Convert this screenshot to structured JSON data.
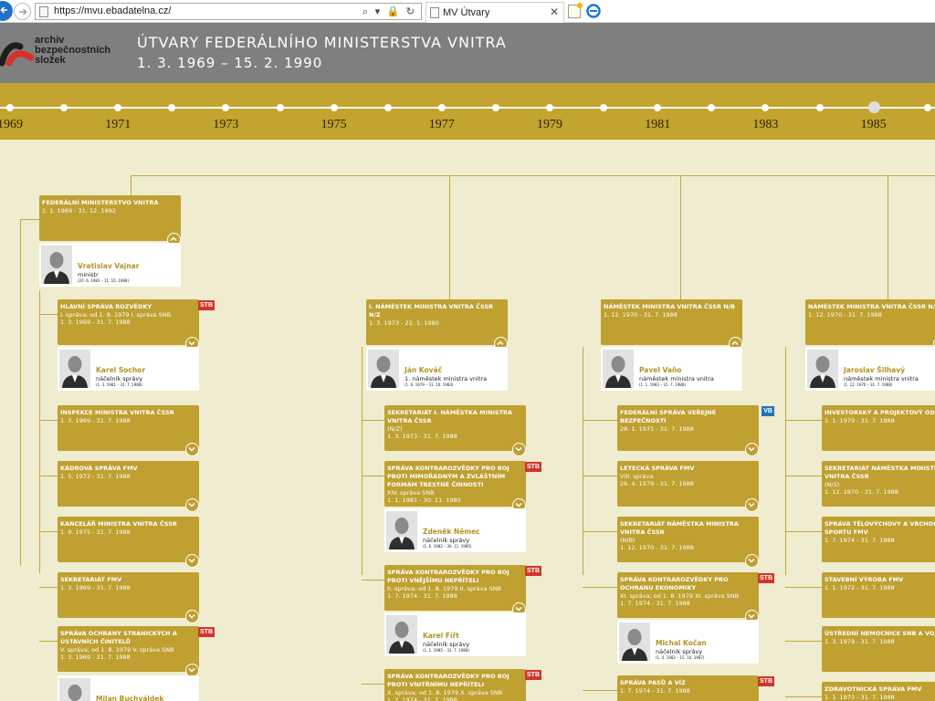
{
  "browser": {
    "url": "https://mvu.ebadatelna.cz/",
    "address_tools": "⌕ ▾ 🔒 ↻",
    "tab_title": "MV Útvary",
    "tab_close": "✕"
  },
  "header": {
    "logo_line1": "archiv",
    "logo_line2": "bezpečnostních",
    "logo_line3": "složek",
    "title": "ÚTVARY FEDERÁLNÍHO MINISTERSTVA VNITRA",
    "subtitle": "1. 3. 1969 – 15. 2. 1990"
  },
  "timeline": {
    "years": [
      "1969",
      "1971",
      "1973",
      "1975",
      "1977",
      "1979",
      "1981",
      "1983",
      "1985"
    ]
  },
  "colors": {
    "gold": "#bfa030",
    "header_gray": "#7f7f7f",
    "background": "#efeccf",
    "stb_badge": "#d2362a",
    "vb_badge": "#2473b8",
    "person_name": "#b19420"
  },
  "org": {
    "root": {
      "name": "FEDERÁLNÍ MINISTERSTVO VNITRA",
      "dates": "1. 1. 1969 - 31. 12. 1992",
      "person": {
        "name": "Vratislav Vajnar",
        "role": "ministr",
        "dates": "(20. 6. 1983 – 11. 10. 1988)"
      }
    },
    "col1": [
      {
        "name": "HLAVNÍ SPRÁVA ROZVĚDKY",
        "note": "I. správa; od 1. 8. 1979 I. správa SNB",
        "dates": "1. 3. 1969 - 31. 7. 1988",
        "badge": "STB",
        "person": {
          "name": "Karel Sochor",
          "role": "náčelník správy",
          "dates": "(1. 3. 1981 – 31. 7. 1988)"
        }
      },
      {
        "name": "INSPEKCE MINISTRA VNITRA ČSSR",
        "dates": "1. 3. 1969 - 31. 7. 1988"
      },
      {
        "name": "KÁDROVÁ SPRÁVA FMV",
        "dates": "1. 5. 1972 - 31. 7. 1988"
      },
      {
        "name": "KANCELÁŘ MINISTRA VNITRA ČSSR",
        "dates": "1. 9. 1975 - 31. 7. 1988"
      },
      {
        "name": "SEKRETARIÁT FMV",
        "dates": "1. 3. 1969 - 31. 7. 1988"
      },
      {
        "name": "SPRÁVA OCHRANY STRANICKÝCH A ÚSTAVNÍCH ČINITELŮ",
        "note": "V. správa; od 1. 8. 1979 V. správa SNB",
        "dates": "1. 3. 1969 - 31. 7. 1988",
        "badge": "STB",
        "person": {
          "name": "Milan Buchváldek"
        }
      }
    ],
    "col2": {
      "head": {
        "name": "I. NÁMĚSTEK MINISTRA VNITRA ČSSR N/Z",
        "dates": "1. 3. 1973 - 22. 1. 1990",
        "person": {
          "name": "Ján Kováč",
          "role": "1. náměstek ministra vnitra",
          "dates": "(1. 6. 1979 – 31. 10. 1983)"
        }
      },
      "items": [
        {
          "name": "SEKRETARIÁT I. NÁMĚSTKA MINISTRA VNITRA ČSSR",
          "note": "(N/Z)",
          "dates": "1. 3. 1973 - 31. 7. 1988"
        },
        {
          "name": "SPRÁVA KONTRAROZVĚDKY PRO BOJ PROTI MIMOŘÁDNÝM A ZVLÁŠTNÍM FORMÁM TRESTNÉ ČINNOSTI",
          "note": "XIV. správa SNB",
          "dates": "1. 1. 1981 - 30. 11. 1985",
          "badge": "STB",
          "person": {
            "name": "Zdeněk Němec",
            "role": "náčelník správy",
            "dates": "(1. 6. 1982 – 30. 11. 1985)"
          }
        },
        {
          "name": "SPRÁVA KONTRAROZVĚDKY PRO BOJ PROTI VNĚJŠÍMU NEPŘÍTELI",
          "note": "II. správa; od 1. 8. 1979 II. správa SNB",
          "dates": "1. 7. 1974 - 31. 7. 1988",
          "badge": "STB",
          "person": {
            "name": "Karel Fířt",
            "role": "náčelník správy",
            "dates": "(1. 1. 1985 – 31. 7. 1988)"
          }
        },
        {
          "name": "SPRÁVA KONTRAROZVĚDKY PRO BOJ PROTI VNITŘNÍMU NEPŘÍTELI",
          "note": "X. správa; od 1. 8. 1979 X. správa SNB",
          "dates": "1. 7. 1974 - 31. 7. 1988",
          "badge": "STB"
        }
      ]
    },
    "col3": {
      "head": {
        "name": "NÁMĚSTEK MINISTRA VNITRA ČSSR N/B",
        "dates": "1. 12. 1970 - 31. 7. 1988",
        "person": {
          "name": "Pavel Vaňo",
          "role": "náměstek ministra vnitra",
          "dates": "(1. 1. 1983 – 31. 7. 1988)"
        }
      },
      "items": [
        {
          "name": "FEDERÁLNÍ SPRÁVA VEŘEJNÉ BEZPEČNOSTI",
          "dates": "28. 1. 1971 - 31. 7. 1988",
          "badge": "VB"
        },
        {
          "name": "LETECKÁ SPRÁVA FMV",
          "note": "VIII. správa",
          "dates": "26. 4. 1979 - 31. 7. 1988"
        },
        {
          "name": "SEKRETARIÁT NÁMĚSTKA MINISTRA VNITRA ČSSR",
          "note": "(N/B)",
          "dates": "1. 12. 1970 - 31. 7. 1988"
        },
        {
          "name": "SPRÁVA KONTRAROZVĚDKY PRO OCHRANU EKONOMIKY",
          "note": "XI. správa; od 1. 8. 1979 XI. správa SNB",
          "dates": "1. 7. 1974 - 31. 7. 1988",
          "badge": "STB",
          "person": {
            "name": "Michal Kočan",
            "role": "náčelník správy",
            "dates": "(1. 4. 1982 – 15. 10. 1987)"
          }
        },
        {
          "name": "SPRÁVA PASŮ A VÍZ",
          "dates": "1. 7. 1974 - 31. 7. 1988",
          "badge": "STB"
        }
      ]
    },
    "col4": {
      "head": {
        "name": "NÁMĚSTEK MINISTRA VNITRA ČSSR N/S",
        "dates": "1. 12. 1970 - 31. 7. 1988",
        "person": {
          "name": "Jaroslav Šilhavý",
          "role": "náměstek ministra vnitra",
          "dates": "(1. 12. 1970 – 31. 7. 1988)"
        }
      },
      "items": [
        {
          "name": "INVESTORSKÝ A PROJEKTOVÝ ODBOR",
          "dates": "1. 1. 1979 - 31. 7. 1988"
        },
        {
          "name": "SEKRETARIÁT NÁMĚSTKA MINISTRA VNITRA ČSSR",
          "note": "(N/S)",
          "dates": "1. 12. 1970 - 31. 7. 1988"
        },
        {
          "name": "SPRÁVA TĚLOVÝCHOVY A VRCHOL. SPORTU FMV",
          "dates": "1. 7. 1974 - 31. 7. 1988"
        },
        {
          "name": "STAVEBNÍ VÝROBA FMV",
          "dates": "1. 1. 1972 - 31. 7. 1988"
        },
        {
          "name": "Ústřední nemocnice SNB a vojsk",
          "dates": "1. 3. 1979 - 31. 7. 1988"
        },
        {
          "name": "ZDRAVOTNICKÁ SPRÁVA FMV",
          "dates": "1. 1. 1973 - 31. 7. 1988"
        }
      ]
    }
  }
}
